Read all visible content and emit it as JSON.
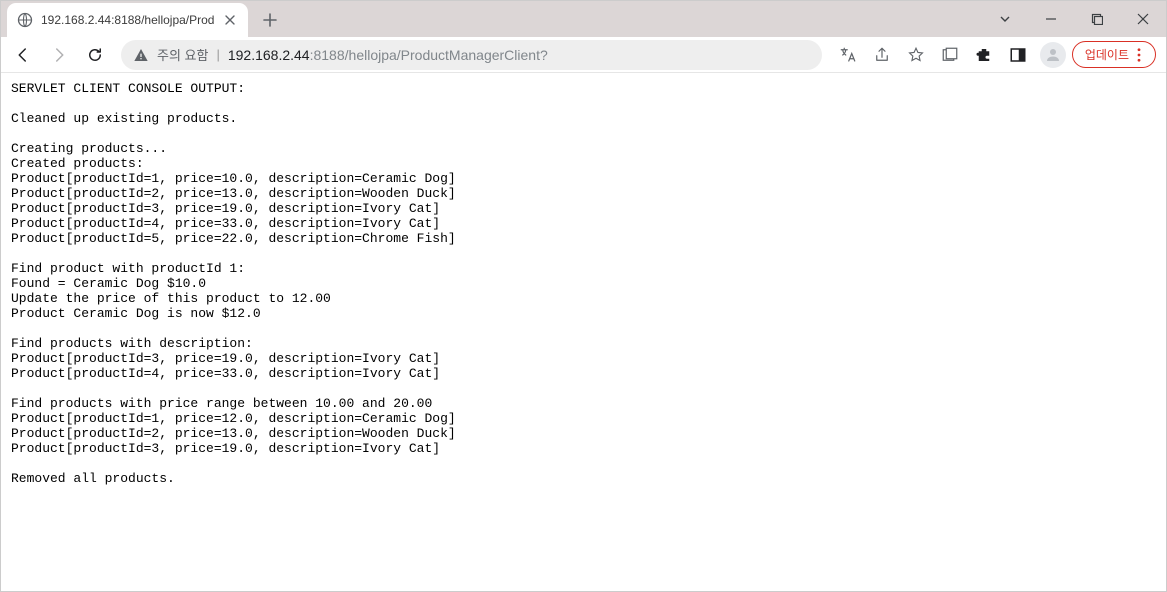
{
  "window": {
    "tab_title": "192.168.2.44:8188/hellojpa/Prod"
  },
  "toolbar": {
    "warning_label": "주의 요함",
    "url_host": "192.168.2.44",
    "url_port": ":8188",
    "url_path": "/hellojpa/ProductManagerClient?",
    "update_label": "업데이트"
  },
  "page": {
    "lines": [
      "SERVLET CLIENT CONSOLE OUTPUT:",
      "",
      "Cleaned up existing products.",
      "",
      "Creating products...",
      "Created products:",
      "Product[productId=1, price=10.0, description=Ceramic Dog]",
      "Product[productId=2, price=13.0, description=Wooden Duck]",
      "Product[productId=3, price=19.0, description=Ivory Cat]",
      "Product[productId=4, price=33.0, description=Ivory Cat]",
      "Product[productId=5, price=22.0, description=Chrome Fish]",
      "",
      "Find product with productId 1:",
      "Found = Ceramic Dog $10.0",
      "Update the price of this product to 12.00",
      "Product Ceramic Dog is now $12.0",
      "",
      "Find products with description:",
      "Product[productId=3, price=19.0, description=Ivory Cat]",
      "Product[productId=4, price=33.0, description=Ivory Cat]",
      "",
      "Find products with price range between 10.00 and 20.00",
      "Product[productId=1, price=12.0, description=Ceramic Dog]",
      "Product[productId=2, price=13.0, description=Wooden Duck]",
      "Product[productId=3, price=19.0, description=Ivory Cat]",
      "",
      "Removed all products."
    ]
  }
}
